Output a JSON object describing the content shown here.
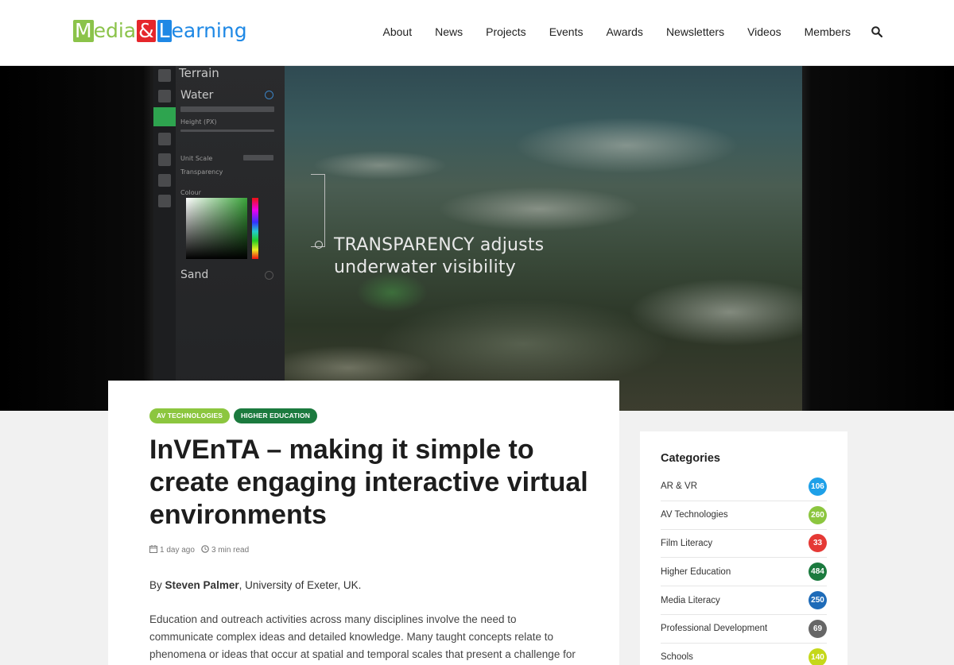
{
  "header": {
    "logo": {
      "part1": "M",
      "part2": "edia",
      "part3": "&",
      "part4": "L",
      "part5": "earning"
    },
    "nav": [
      "About",
      "News",
      "Projects",
      "Events",
      "Awards",
      "Newsletters",
      "Videos",
      "Members"
    ],
    "search_icon": "search-icon"
  },
  "hero": {
    "panel": {
      "terrain": "Terrain",
      "water": "Water",
      "height": "Height (PX)",
      "unit_scale": "Unit Scale",
      "transparency": "Transparency",
      "colour": "Colour",
      "sand": "Sand"
    },
    "caption_line1": "TRANSPARENCY adjusts",
    "caption_line2": "underwater visibility"
  },
  "article": {
    "tags": [
      "AV TECHNOLOGIES",
      "HIGHER EDUCATION"
    ],
    "tag_colors": [
      "#8cc63f",
      "#1b7a3e"
    ],
    "title": "InVEnTA – making it simple to create engaging interactive virtual environments",
    "date": "1 day ago",
    "read_time": "3 min read",
    "by": "By",
    "author": "Steven Palmer",
    "affiliation": ", University of Exeter, UK.",
    "body": "Education and outreach activities across many disciplines involve the need to communicate complex ideas and detailed knowledge. Many taught concepts relate to phenomena or ideas that occur at spatial and temporal scales that present a challenge for visualisation – from the"
  },
  "sidebar": {
    "title": "Categories",
    "categories": [
      {
        "label": "AR & VR",
        "count": "106",
        "color": "#1ea0e8"
      },
      {
        "label": "AV Technologies",
        "count": "260",
        "color": "#8cc63f"
      },
      {
        "label": "Film Literacy",
        "count": "33",
        "color": "#e53935"
      },
      {
        "label": "Higher Education",
        "count": "484",
        "color": "#1b7a3e"
      },
      {
        "label": "Media Literacy",
        "count": "250",
        "color": "#1e6bb8"
      },
      {
        "label": "Professional Development",
        "count": "69",
        "color": "#666666"
      },
      {
        "label": "Schools",
        "count": "140",
        "color": "#c5d81a"
      }
    ]
  }
}
